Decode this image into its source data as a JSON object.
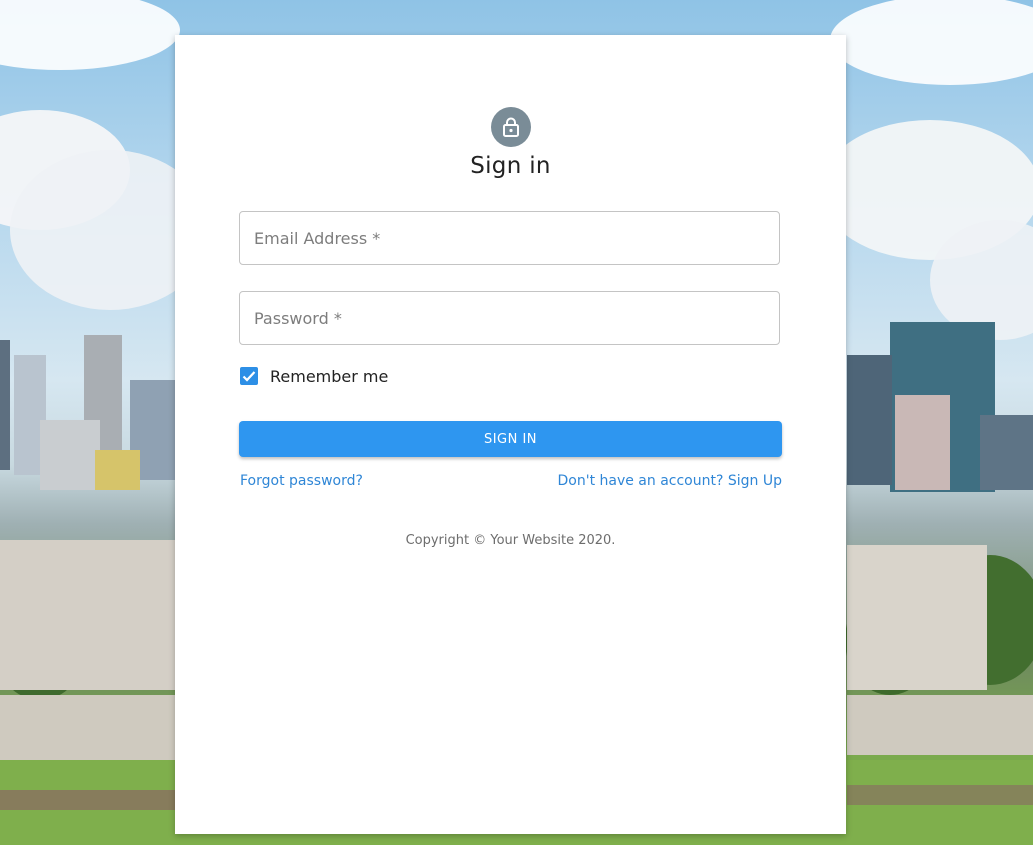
{
  "form": {
    "title": "Sign in",
    "email_placeholder": "Email Address *",
    "password_placeholder": "Password *",
    "remember_label": "Remember me",
    "remember_checked": true,
    "signin_label": "SIGN IN",
    "forgot_label": "Forgot password?",
    "signup_label": "Don't have an account? Sign Up",
    "copyright": "Copyright © Your Website 2020."
  },
  "icons": {
    "avatar": "lock-icon",
    "checkbox": "check-icon"
  },
  "colors": {
    "primary": "#2e96f0",
    "link": "#2f86d6",
    "avatar_bg": "#7a8c97"
  }
}
